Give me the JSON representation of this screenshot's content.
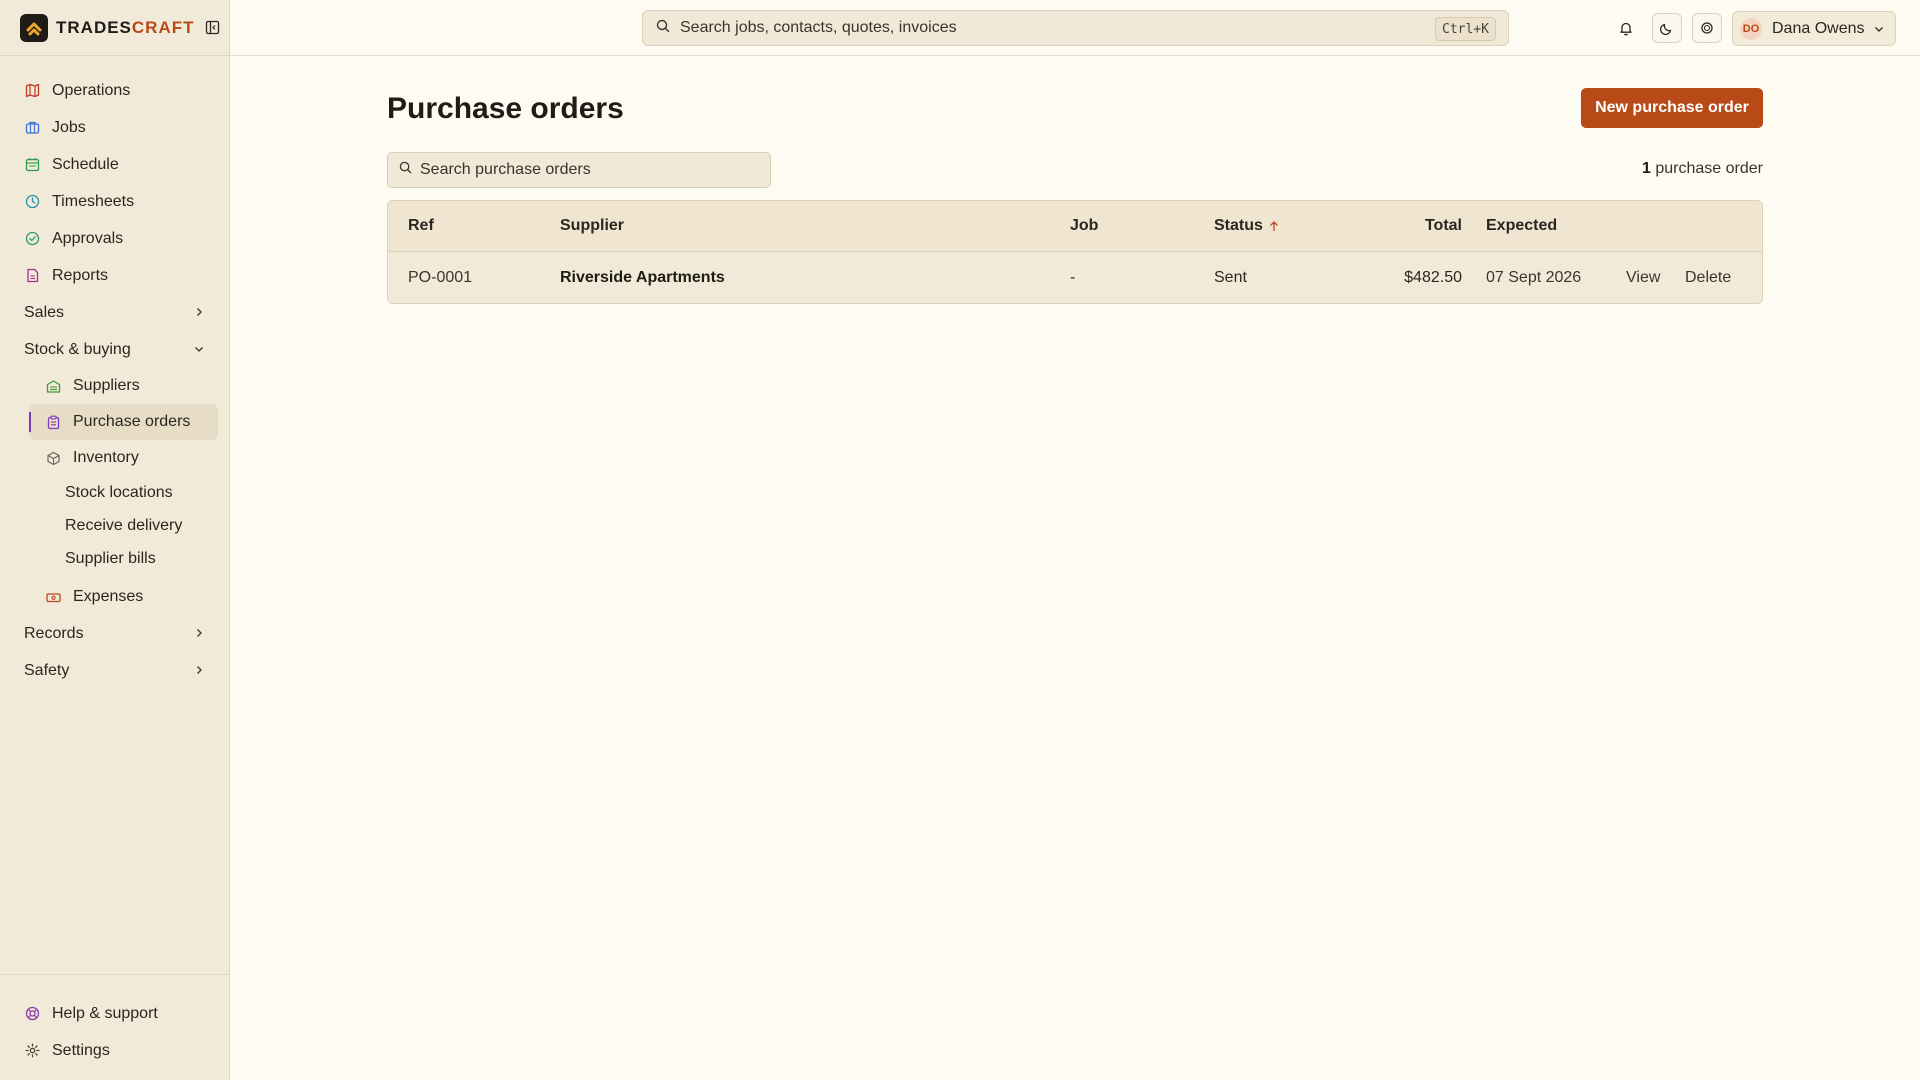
{
  "brand": {
    "part1": "TRADES",
    "part2": "CRAFT"
  },
  "topbar": {
    "search_placeholder": "Search jobs, contacts, quotes, invoices",
    "shortcut": "Ctrl+K",
    "user_initials": "DO",
    "user_name": "Dana Owens"
  },
  "sidebar": {
    "items": [
      {
        "label": "Operations",
        "icon": "map-icon",
        "color": "#c0392b"
      },
      {
        "label": "Jobs",
        "icon": "briefcase-icon",
        "color": "#3b6fd1"
      },
      {
        "label": "Schedule",
        "icon": "calendar-icon",
        "color": "#2e9b4f"
      },
      {
        "label": "Timesheets",
        "icon": "clock-icon",
        "color": "#2a8fb0"
      },
      {
        "label": "Approvals",
        "icon": "check-circle-icon",
        "color": "#2e9b6f"
      },
      {
        "label": "Reports",
        "icon": "file-chart-icon",
        "color": "#a0308a"
      }
    ],
    "groups": {
      "sales": "Sales",
      "stock": "Stock & buying",
      "records": "Records",
      "safety": "Safety"
    },
    "stock_items": {
      "suppliers": "Suppliers",
      "purchase_orders": "Purchase orders",
      "inventory": "Inventory",
      "stock_locations": "Stock locations",
      "receive_delivery": "Receive delivery",
      "supplier_bills": "Supplier bills",
      "expenses": "Expenses"
    },
    "bottom": {
      "help": "Help & support",
      "settings": "Settings"
    }
  },
  "main": {
    "title": "Purchase orders",
    "new_button": "New purchase order",
    "search_placeholder": "Search purchase orders",
    "count_number": "1",
    "count_label": " purchase order",
    "columns": {
      "ref": "Ref",
      "supplier": "Supplier",
      "job": "Job",
      "status": "Status",
      "total": "Total",
      "expected": "Expected"
    },
    "rows": [
      {
        "ref": "PO-0001",
        "supplier": "Riverside Apartments",
        "job": "-",
        "status": "Sent",
        "total": "$482.50",
        "expected": "07 Sept 2026",
        "view": "View",
        "delete": "Delete"
      }
    ]
  },
  "colors": {
    "accent": "#b84a18",
    "sidebar_bg": "#f2ead9",
    "page_bg": "#fefbf3"
  }
}
